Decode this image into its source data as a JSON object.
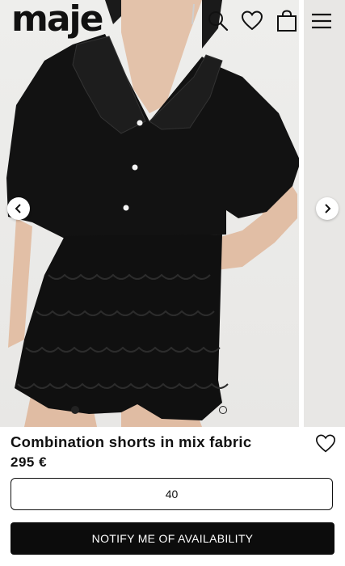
{
  "header": {
    "logo": "maje",
    "icons": [
      "search-icon",
      "heart-icon",
      "bag-icon",
      "menu-icon"
    ]
  },
  "gallery": {
    "slide_count": 2,
    "active_slide": 1,
    "prev_icon": "chevron-left-icon",
    "next_icon": "chevron-right-icon"
  },
  "product": {
    "title": "Combination shorts in mix fabric",
    "price": "295 €",
    "wishlist_icon": "heart-icon"
  },
  "size_selector": {
    "value": "40"
  },
  "cta": {
    "label": "NOTIFY ME OF AVAILABILITY"
  },
  "colors": {
    "primary": "#0c0c0c",
    "background": "#ffffff"
  }
}
